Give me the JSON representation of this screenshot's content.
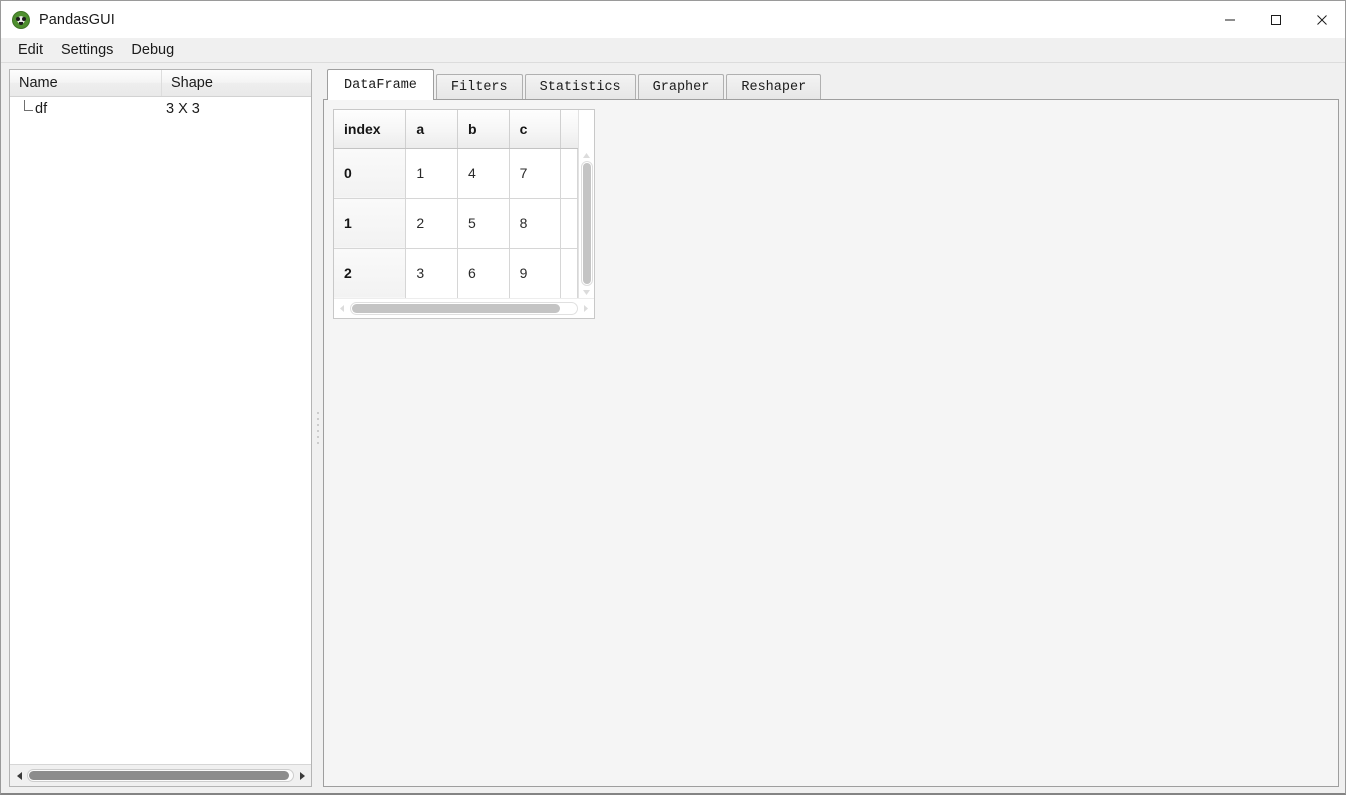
{
  "window": {
    "title": "PandasGUI",
    "app_icon": "panda-logo-icon",
    "controls": {
      "minimize": "minimize-icon",
      "maximize": "maximize-icon",
      "close": "close-icon"
    }
  },
  "menubar": {
    "items": [
      {
        "label": "Edit"
      },
      {
        "label": "Settings"
      },
      {
        "label": "Debug"
      }
    ]
  },
  "sidebar": {
    "headers": {
      "name": "Name",
      "shape": "Shape"
    },
    "rows": [
      {
        "name": "df",
        "shape": "3 X 3"
      }
    ],
    "scrollbar": {
      "left_arrow": "arrow-left-icon",
      "right_arrow": "arrow-right-icon"
    }
  },
  "main": {
    "tabs": [
      {
        "label": "DataFrame",
        "active": true
      },
      {
        "label": "Filters",
        "active": false
      },
      {
        "label": "Statistics",
        "active": false
      },
      {
        "label": "Grapher",
        "active": false
      },
      {
        "label": "Reshaper",
        "active": false
      }
    ],
    "table": {
      "columns": [
        "index",
        "a",
        "b",
        "c"
      ],
      "rows": [
        {
          "index": "0",
          "a": "1",
          "b": "4",
          "c": "7"
        },
        {
          "index": "1",
          "a": "2",
          "b": "5",
          "c": "8"
        },
        {
          "index": "2",
          "a": "3",
          "b": "6",
          "c": "9"
        }
      ]
    }
  }
}
